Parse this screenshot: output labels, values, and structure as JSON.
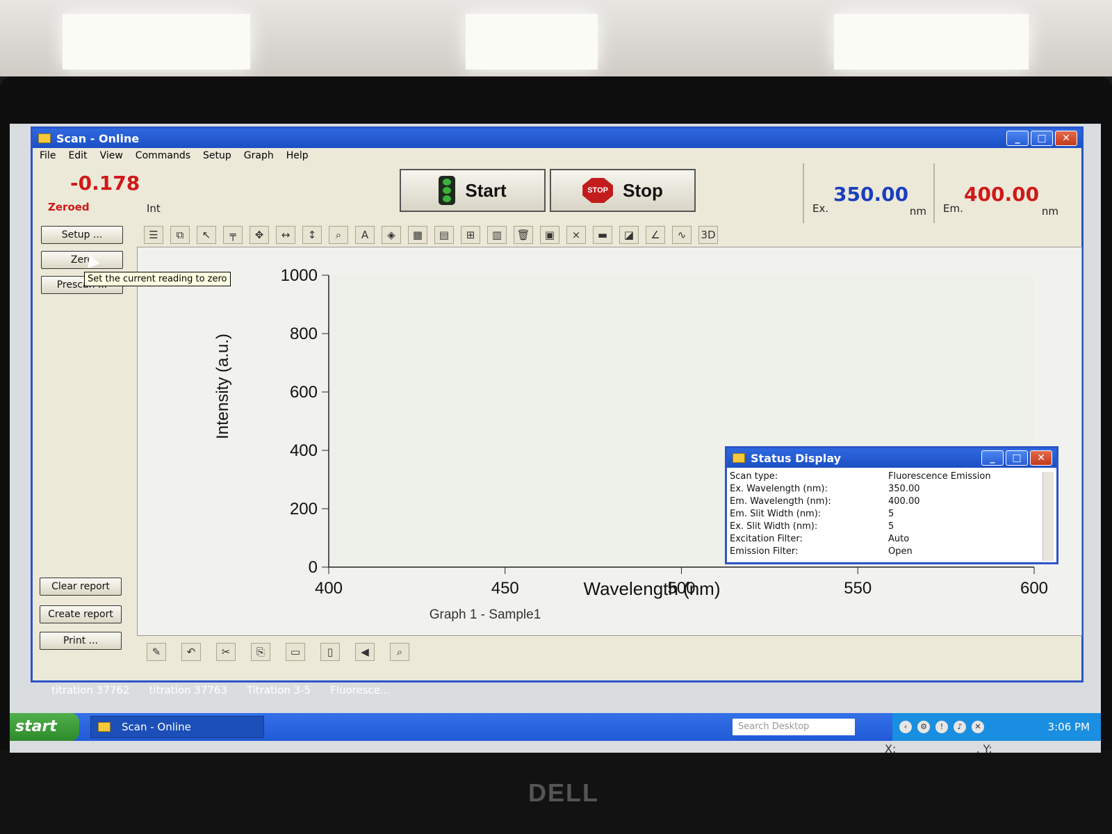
{
  "window": {
    "title": "Scan - Online"
  },
  "menu": [
    "File",
    "Edit",
    "View",
    "Commands",
    "Setup",
    "Graph",
    "Help"
  ],
  "reading": {
    "value": "-0.178",
    "status": "Zeroed",
    "unit": "Int"
  },
  "controls": {
    "start_label": "Start",
    "stop_label": "Stop",
    "stop_icon_text": "STOP"
  },
  "excitation": {
    "value": "350.00",
    "label": "Ex.",
    "unit": "nm",
    "color": "#1a3fbf"
  },
  "emission": {
    "value": "400.00",
    "label": "Em.",
    "unit": "nm",
    "color": "#d01818"
  },
  "side_buttons": {
    "setup": "Setup ...",
    "zero": "Zero",
    "prescan": "Prescan ...",
    "clear_report": "Clear report",
    "create_report": "Create report",
    "print": "Print ..."
  },
  "tooltip": "Set the current reading to zero",
  "graph": {
    "caption": "Graph 1 - Sample1",
    "x_readout": "X:",
    "y_readout": ", Y:"
  },
  "chart_data": {
    "type": "line",
    "xlabel": "Wavelength (nm)",
    "ylabel": "Intensity (a.u.)",
    "xlim": [
      400,
      600
    ],
    "ylim": [
      0,
      1000
    ],
    "x_ticks": [
      400,
      450,
      500,
      550,
      600
    ],
    "y_ticks": [
      0,
      200,
      400,
      600,
      800,
      1000
    ],
    "series": []
  },
  "status_display": {
    "title": "Status Display",
    "rows": [
      {
        "key": "Scan type:",
        "value": "Fluorescence Emission"
      },
      {
        "key": "Ex. Wavelength (nm):",
        "value": "350.00"
      },
      {
        "key": "Em. Wavelength (nm):",
        "value": "400.00"
      },
      {
        "key": "Em. Slit Width (nm):",
        "value": "5"
      },
      {
        "key": "Ex. Slit Width (nm):",
        "value": "5"
      },
      {
        "key": "Excitation Filter:",
        "value": "Auto"
      },
      {
        "key": "Emission Filter:",
        "value": "Open"
      }
    ]
  },
  "desktop_icons": [
    "titration 37762",
    "titration 37763",
    "Titration 3-5",
    "Fluoresce..."
  ],
  "taskbar": {
    "start_label": "start",
    "task_title": "Scan - Online",
    "search_placeholder": "Search Desktop",
    "clock": "3:06 PM"
  }
}
